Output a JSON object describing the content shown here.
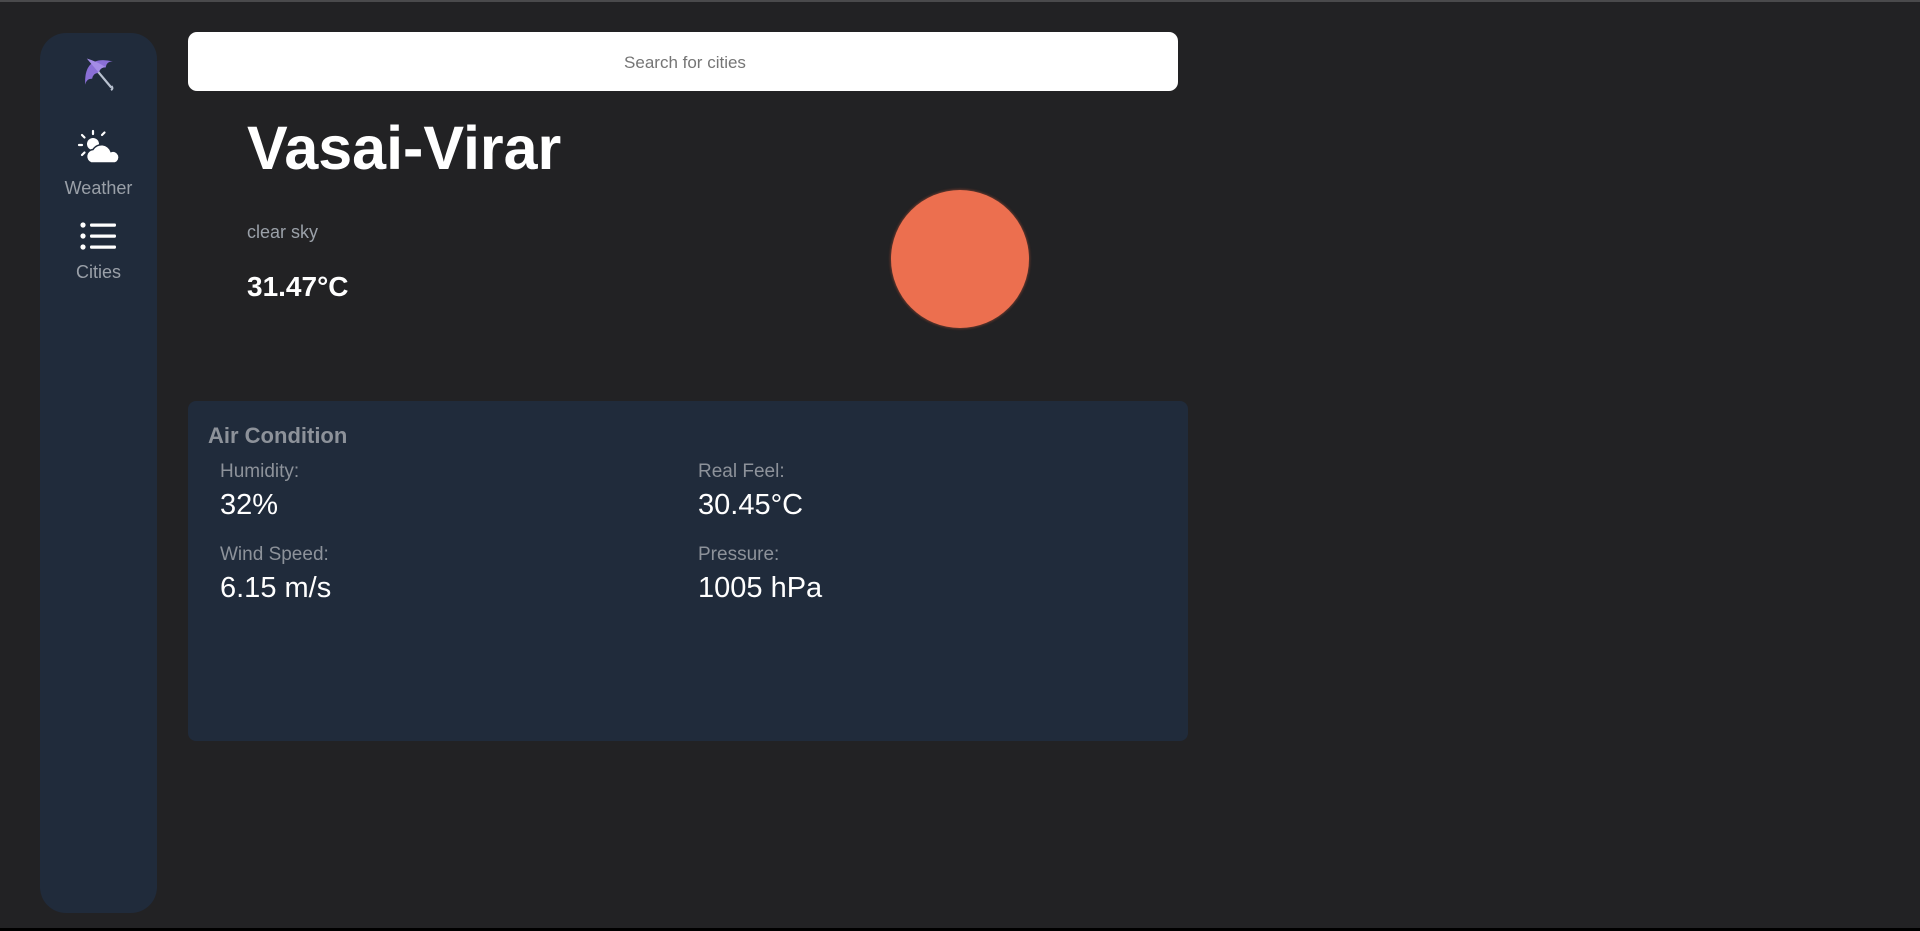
{
  "sidebar": {
    "logo_icon": "umbrella-icon",
    "items": [
      {
        "label": "Weather",
        "icon": "cloud-sun-icon"
      },
      {
        "label": "Cities",
        "icon": "list-icon"
      }
    ]
  },
  "search": {
    "placeholder": "Search for cities",
    "value": ""
  },
  "current": {
    "city": "Vasai-Virar",
    "description": "clear sky",
    "temperature": "31.47°C",
    "weather_icon": "sun-icon"
  },
  "air_condition": {
    "title": "Air Condition",
    "metrics": [
      {
        "label": "Humidity:",
        "value": "32%"
      },
      {
        "label": "Real Feel:",
        "value": "30.45°C"
      },
      {
        "label": "Wind Speed:",
        "value": "6.15 m/s"
      },
      {
        "label": "Pressure:",
        "value": "1005 hPa"
      }
    ]
  },
  "colors": {
    "background": "#222224",
    "panel": "#202b3b",
    "sun": "#ec6f4f",
    "muted_text": "#9aa0a8"
  }
}
